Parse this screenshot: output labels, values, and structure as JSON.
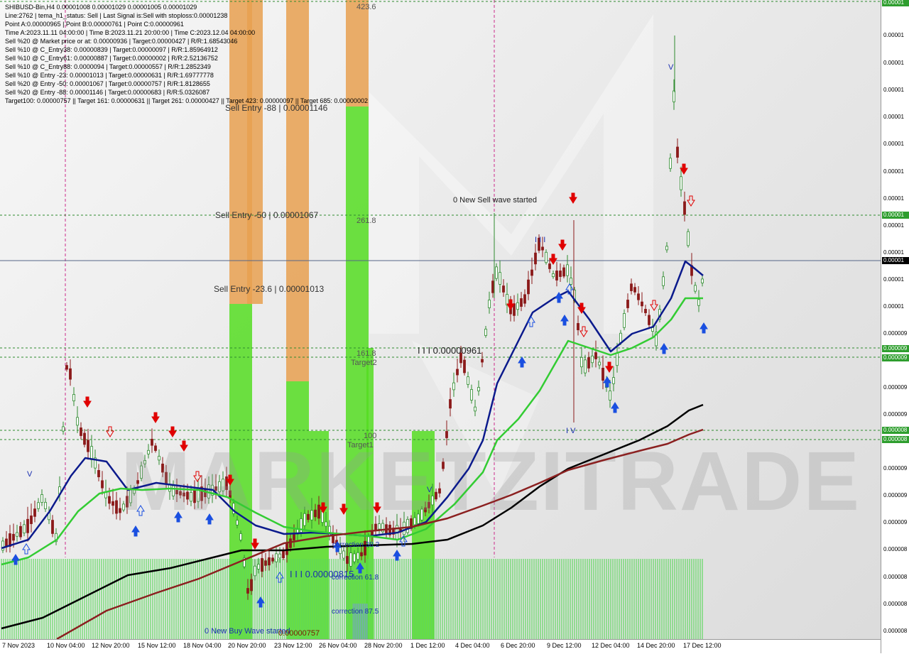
{
  "info_lines": [
    "SHIBUSD-Bin,H4  0.00001008 0.00001029 0.00001005 0.00001029",
    "Line:2762 | tema_h1_status: Sell | Last Signal is:Sell with stoploss:0.00001238",
    "Point A:0.00000965 | Point B:0.00000761 | Point C:0.00000961",
    "Time A:2023.11.11 04:00:00 | Time B:2023.11.21 20:00:00 | Time C:2023.12.04 04:00:00",
    "Sell %20 @ Market price or at: 0.00000936 | Target:0.00000427 | R/R:1.68543046",
    "Sell %10 @ C_Entry38: 0.00000839 | Target:0.00000097 | R/R:1.85964912",
    "Sell %10 @ C_Entry61: 0.00000887 | Target:0.00000002 | R/R:2.52136752",
    "Sell %10 @ C_Entry88: 0.0000094 | Target:0.00000557 | R/R:1.2852349",
    "Sell %10 @ Entry -23: 0.00001013 | Target:0.00000631 | R/R:1.69777778",
    "Sell %20 @ Entry -50: 0.00001067 | Target:0.00000757 | R/R:1.8128655",
    "Sell %20 @ Entry -88: 0.00001146 | Target:0.00000683 | R/R:5.0326087",
    "Target100: 0.00000757 || Target 161: 0.00000631 || Target 261: 0.00000427 || Target 423: 0.00000097 || Target 685: 0.00000002"
  ],
  "chart_texts": {
    "fib_423": "423.6",
    "fib_261": "261.8",
    "fib_161": "161.8",
    "target2": "Target2",
    "fib_100": "100",
    "target1": "Target1",
    "sell_wave": "0 New Sell wave started",
    "buy_wave": "0 New Buy Wave started",
    "point_c": "I I I 0.00000961",
    "point_b": "I I I 0.00000815",
    "corr_38": "correction 38.2",
    "corr_61": "correction 61.8",
    "corr_87": "correction 87.5",
    "stoploss_label": "0.00000757",
    "wave_v_top": "V",
    "wave_iv": "I V",
    "wave_iii": "I I I",
    "wave_v_left": "V",
    "wave_v_mid": "V"
  },
  "level_labels": {
    "sell_88": "Sell Entry -88 | 0.00001146",
    "sell_50": "Sell Entry -50 | 0.00001067",
    "sell_23": "Sell Entry -23.6 | 0.00001013"
  },
  "price_axis": {
    "labels": [
      "0.00001",
      "0.00001",
      "0.00001",
      "0.00001",
      "0.00001",
      "0.00001",
      "0.00001",
      "0.00001",
      "0.00001",
      "0.00001",
      "0.00001",
      "0.000009",
      "0.000009",
      "0.000009",
      "0.000009",
      "0.000009",
      "0.000009",
      "0.000008",
      "0.000008",
      "0.000008",
      "0.000008",
      "0.000008",
      "0.000008",
      "0.000007"
    ],
    "badge_top": "0.00001",
    "badge_sell50": "0.00001",
    "badge_current": "0.00001",
    "badge_t2a": "0.000009",
    "badge_t2b": "0.000009",
    "badge_t1a": "0.000008",
    "badge_t1b": "0.000008"
  },
  "time_axis": [
    "7 Nov 2023",
    "10 Nov 04:00",
    "12 Nov 20:00",
    "15 Nov 12:00",
    "18 Nov 04:00",
    "20 Nov 20:00",
    "23 Nov 12:00",
    "26 Nov 04:00",
    "28 Nov 20:00",
    "1 Dec 12:00",
    "4 Dec 04:00",
    "6 Dec 20:00",
    "9 Dec 12:00",
    "12 Dec 04:00",
    "14 Dec 20:00",
    "17 Dec 12:00"
  ],
  "watermark": "MARKETZITRADE",
  "colors": {
    "bull_candle": "#2e8b2e",
    "bear_candle": "#8b1a1a",
    "ma_blue": "#0b1a8c",
    "ma_green": "#33cc33",
    "ma_black": "#000000",
    "ma_red": "#8b2020",
    "zone_orange": "#e8a050",
    "zone_green": "#55dd22",
    "sell_arrow": "#e00000",
    "buy_arrow": "#1a4fe0"
  }
}
